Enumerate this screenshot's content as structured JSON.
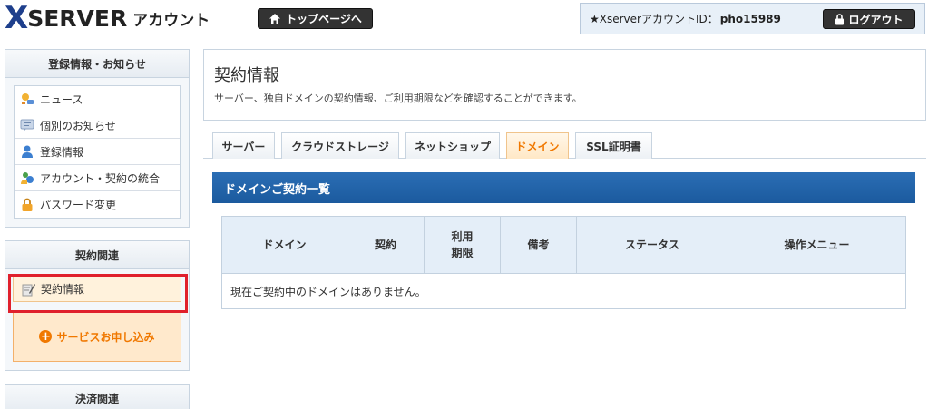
{
  "header": {
    "logo_x": "X",
    "logo_server": "SERVER",
    "logo_account": "アカウント",
    "top_button": "トップページへ",
    "account_label": "★XserverアカウントID：",
    "account_id": "pho15989",
    "logout_button": "ログアウト"
  },
  "sidebar": {
    "section1_title": "登録情報・お知らせ",
    "section1_items": [
      {
        "label": "ニュース",
        "icon": "news-icon"
      },
      {
        "label": "個別のお知らせ",
        "icon": "message-icon"
      },
      {
        "label": "登録情報",
        "icon": "user-icon"
      },
      {
        "label": "アカウント・契約の統合",
        "icon": "merge-icon"
      },
      {
        "label": "パスワード変更",
        "icon": "lock-icon"
      }
    ],
    "section2_title": "契約関連",
    "contract_item": "契約情報",
    "apply_button": "サービスお申し込み",
    "section3_title": "決済関連"
  },
  "main": {
    "title": "契約情報",
    "description": "サーバー、独自ドメインの契約情報、ご利用期限などを確認することができます。",
    "tabs": [
      {
        "label": "サーバー",
        "active": false
      },
      {
        "label": "クラウドストレージ",
        "active": false
      },
      {
        "label": "ネットショップ",
        "active": false
      },
      {
        "label": "ドメイン",
        "active": true
      },
      {
        "label": "SSL証明書",
        "active": false
      }
    ],
    "section_title": "ドメインご契約一覧",
    "table": {
      "columns": [
        "ドメイン",
        "契約",
        "利用\n期限",
        "備考",
        "ステータス",
        "操作メニュー"
      ],
      "empty_message": "現在ご契約中のドメインはありません。"
    }
  },
  "colors": {
    "brand_blue": "#1e3f8c",
    "section_bar": "#1b5a9e",
    "active_tab_text": "#f07800",
    "highlight_frame": "#e0202c"
  }
}
